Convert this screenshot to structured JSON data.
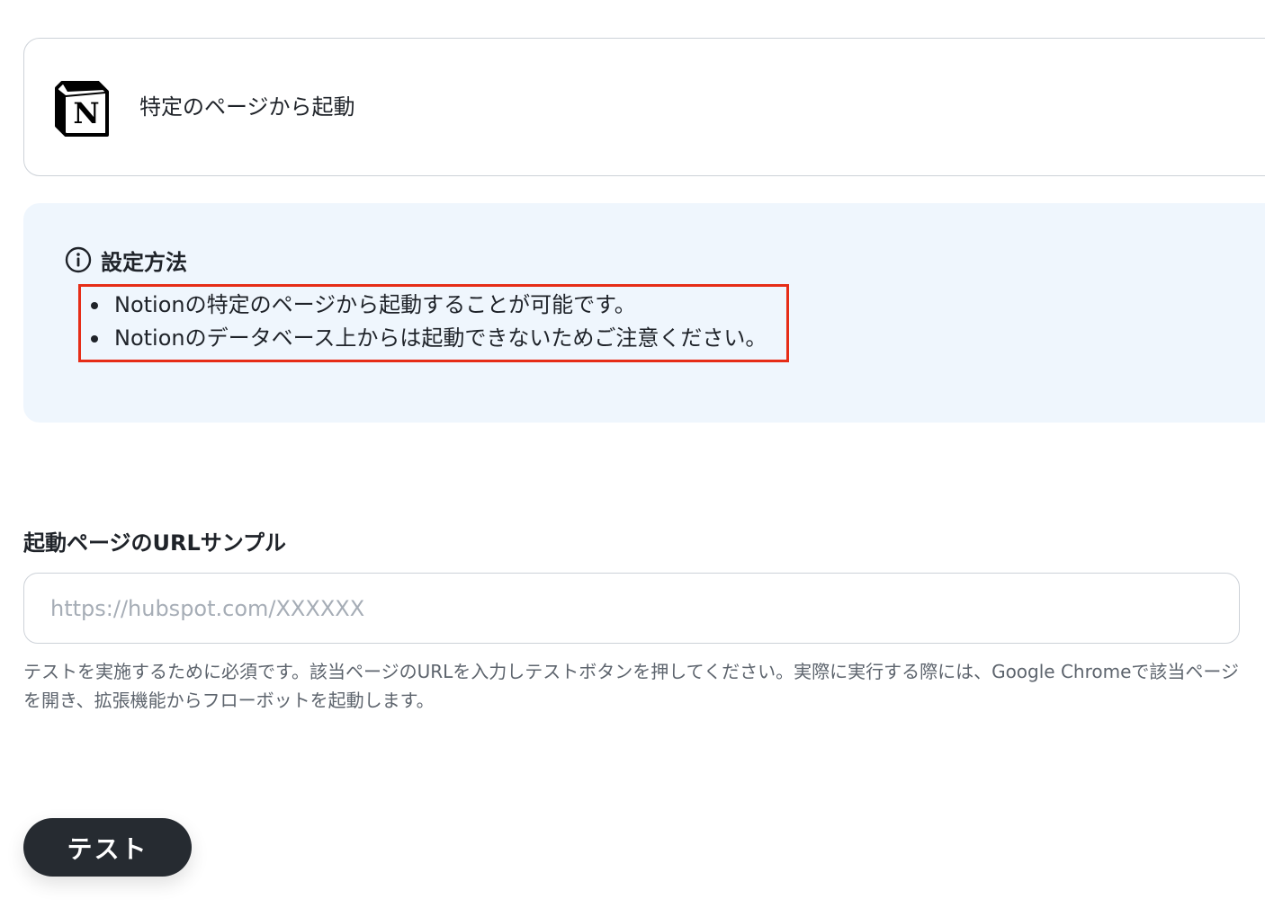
{
  "trigger": {
    "app_icon": "notion-logo",
    "title": "特定のページから起動"
  },
  "info": {
    "icon": "info-circle-icon",
    "title": "設定方法",
    "items": [
      "Notionの特定のページから起動することが可能です。",
      "Notionのデータベース上からは起動できないためご注意ください。"
    ],
    "highlight_color": "#e62d17"
  },
  "url_field": {
    "label": "起動ページのURLサンプル",
    "placeholder": "https://hubspot.com/XXXXXX",
    "value": "",
    "help_text": "テストを実施するために必須です。該当ページのURLを入力しテストボタンを押してください。実際に実行する際には、Google Chromeで該当ページを開き、拡張機能からフローボットを起動します。"
  },
  "test_button": {
    "label": "テスト"
  },
  "colors": {
    "panel_background": "#eff6fd",
    "button_background": "#262b31"
  }
}
